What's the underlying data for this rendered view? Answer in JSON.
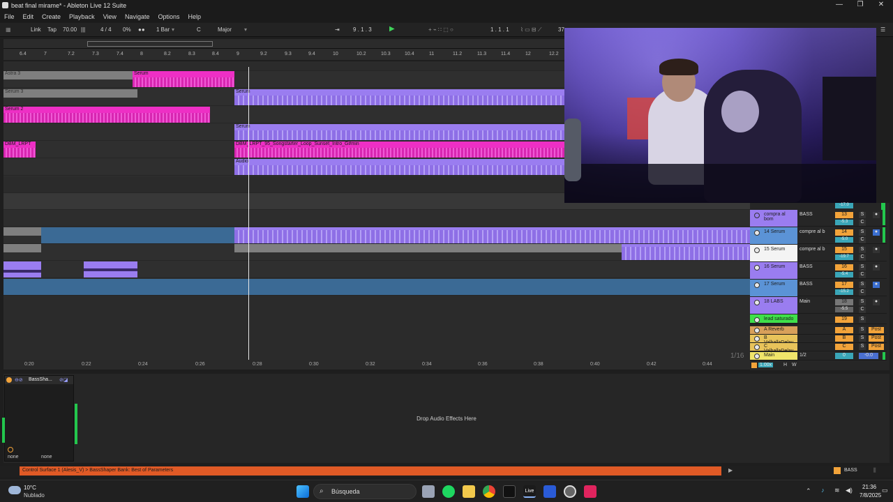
{
  "window": {
    "title": "beat final mirame* - Ableton Live 12 Suite"
  },
  "menu": [
    "File",
    "Edit",
    "Create",
    "Playback",
    "View",
    "Navigate",
    "Options",
    "Help"
  ],
  "control_bar": {
    "link": "Link",
    "tap": "Tap",
    "tempo": "70.00",
    "signature": "4 / 4",
    "swing": "0%",
    "quantize": "1 Bar",
    "key": "C",
    "scale": "Major",
    "position": "9 . 1 . 3",
    "loop_start": "1 . 1 . 1",
    "loop_length_partial": "37"
  },
  "ruler_ticks": [
    "6.4",
    "7",
    "7.2",
    "7.3",
    "7.4",
    "8",
    "8.2",
    "8.3",
    "8.4",
    "9",
    "9.2",
    "9.3",
    "9.4",
    "10",
    "10.2",
    "10.3",
    "10.4",
    "11",
    "11.2",
    "11.3",
    "11.4",
    "12",
    "12.2"
  ],
  "time_ticks": [
    "0:20",
    "0:22",
    "0:24",
    "0:26",
    "0:28",
    "0:30",
    "0:32",
    "0:34",
    "0:36",
    "0:38",
    "0:40",
    "0:42",
    "0:44"
  ],
  "clips": {
    "astra": "Astra 3",
    "serum": "Serum",
    "serum2": "Serum 2",
    "serum3": "Serum 3",
    "dbm": "DBM_LRPT",
    "dbm_loop": "DBM_LRPT_95_Songstarter_Loop_Sunset_Intro_G#min",
    "audio": "Audio"
  },
  "mixer": {
    "top_vol": "-17.0",
    "tracks": [
      {
        "name": "compra al bom",
        "route": "BASS",
        "num": "13",
        "vol": "-5.3",
        "color": "#9a7df0"
      },
      {
        "name": "14 Serum",
        "route": "compre al b",
        "num": "14",
        "vol": "-5.0",
        "color": "#5b93d6"
      },
      {
        "name": "15 Serum",
        "route": "compre al b",
        "num": "15",
        "vol": "-19.7",
        "color": "#f4f4f4"
      },
      {
        "name": "16 Serum",
        "route": "BASS",
        "num": "16",
        "vol": "-5.4",
        "color": "#9a7df0"
      },
      {
        "name": "17 Serum",
        "route": "BASS",
        "num": "17",
        "vol": "-15.2",
        "color": "#5b93d6"
      },
      {
        "name": "18 LABS",
        "route": "Main",
        "num": "18",
        "vol": "-5.5",
        "color": "#9a7df0"
      },
      {
        "name": "lead saturado",
        "route": "",
        "num": "19",
        "vol": "",
        "color": "#3fe04a"
      }
    ],
    "returns": [
      {
        "name": "A Reverb",
        "letter": "A",
        "post": "Post"
      },
      {
        "name": "B ValhallaDelay",
        "letter": "B",
        "post": "Post"
      },
      {
        "name": "C ValhallaDelay",
        "letter": "C",
        "post": "Post"
      }
    ],
    "main": {
      "name": "Main",
      "route": "1/2",
      "num": "0",
      "vol": "-0.0"
    },
    "zoom": "1/16",
    "rate": "1.00x",
    "h": "H",
    "w": "W",
    "s": "S",
    "c": "C"
  },
  "device": {
    "name": "BassSha...",
    "in_a": "none",
    "in_b": "none",
    "drop_hint": "Drop Audio Effects Here"
  },
  "status": {
    "message": "Control Surface 1 (Alesis_V) > BassShaper Bank: Best of Parameters",
    "track": "BASS"
  },
  "taskbar": {
    "temp": "10°C",
    "weather": "Nublado",
    "search": "Búsqueda",
    "time": "21:36",
    "date": "7/8/2025",
    "live": "Live"
  }
}
